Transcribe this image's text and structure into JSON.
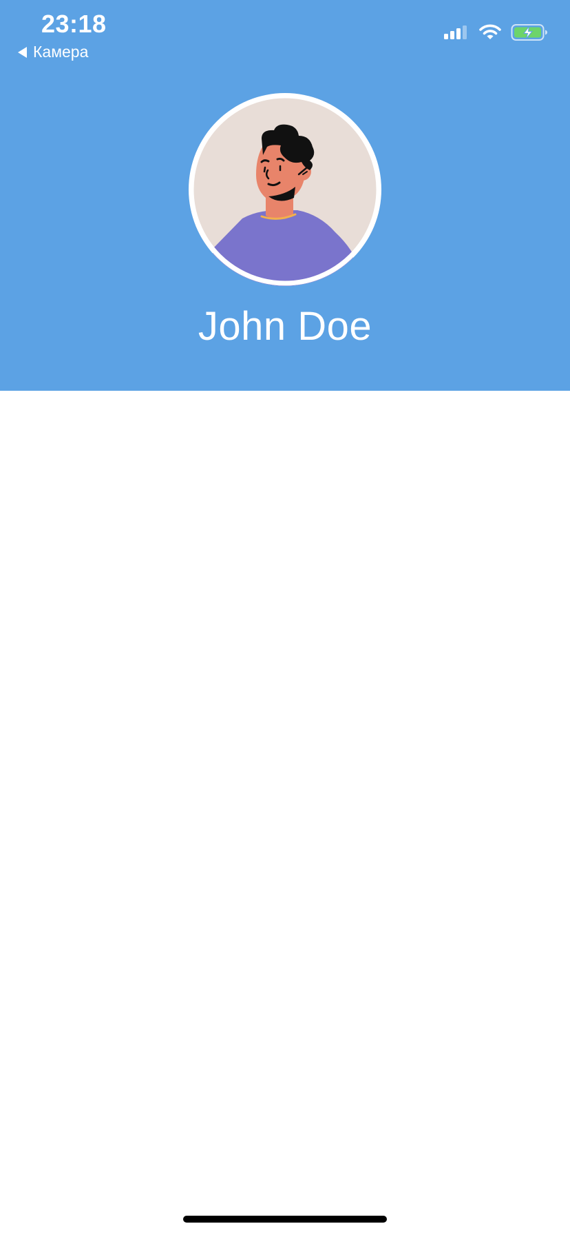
{
  "status_bar": {
    "time": "23:18",
    "back_label": "Камера",
    "icons": [
      "signal-icon",
      "wifi-icon",
      "battery-charging-icon"
    ]
  },
  "profile": {
    "name": "John Doe",
    "avatar_icon": "person-avatar-illustration"
  },
  "colors": {
    "header_background": "#5ca2e4",
    "avatar_background": "#e8ddd7",
    "shirt": "#7a74cc",
    "battery_fill": "#6dd46a"
  }
}
